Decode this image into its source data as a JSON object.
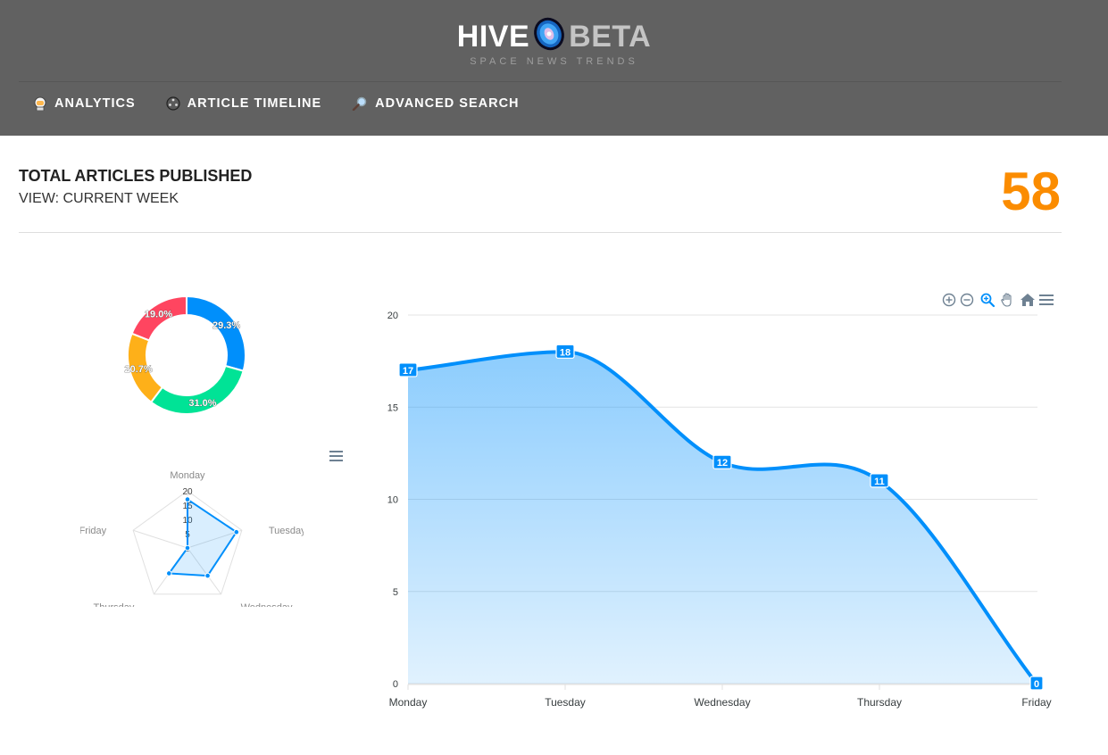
{
  "brand": {
    "name": "HIVE",
    "suffix": "BETA",
    "tagline": "SPACE NEWS TRENDS"
  },
  "nav": {
    "items": [
      {
        "label": "ANALYTICS",
        "icon": "astronaut-icon"
      },
      {
        "label": "ARTICLE TIMELINE",
        "icon": "timeline-icon"
      },
      {
        "label": "ADVANCED SEARCH",
        "icon": "magnifier-icon"
      }
    ]
  },
  "summary": {
    "title": "TOTAL ARTICLES PUBLISHED",
    "view_label": "VIEW: CURRENT WEEK",
    "total": "58",
    "total_color": "#fb8c00"
  },
  "chart_data": [
    {
      "type": "pie",
      "variant": "donut",
      "slice_labels": [
        "29.3%",
        "31.0%",
        "20.7%",
        "19.0%"
      ],
      "values": [
        29.3,
        31.0,
        20.7,
        19.0
      ],
      "colors": [
        "#008ffb",
        "#00e396",
        "#feb019",
        "#ff4560"
      ]
    },
    {
      "type": "radar",
      "axes": [
        "Monday",
        "Tuesday",
        "Wednesday",
        "Thursday",
        "Friday"
      ],
      "values": [
        17,
        18,
        12,
        11,
        0
      ],
      "scale_ticks": [
        "20",
        "15",
        "10",
        "5",
        "0"
      ],
      "ylim": [
        0,
        20
      ],
      "color": "#008ffb"
    },
    {
      "type": "area",
      "curve": "smooth",
      "categories": [
        "Monday",
        "Tuesday",
        "Wednesday",
        "Thursday",
        "Friday"
      ],
      "values": [
        17,
        18,
        12,
        11,
        0
      ],
      "ylim": [
        0,
        20
      ],
      "yticks": [
        20,
        15,
        10,
        5,
        0
      ],
      "grid": true,
      "data_labels": true,
      "color": "#008ffb"
    }
  ],
  "toolbar": {
    "icons": [
      "zoom-in-icon",
      "zoom-out-icon",
      "selection-zoom-icon",
      "pan-icon",
      "reset-home-icon",
      "menu-icon"
    ]
  },
  "radar_menu": {
    "icon": "menu-icon"
  }
}
